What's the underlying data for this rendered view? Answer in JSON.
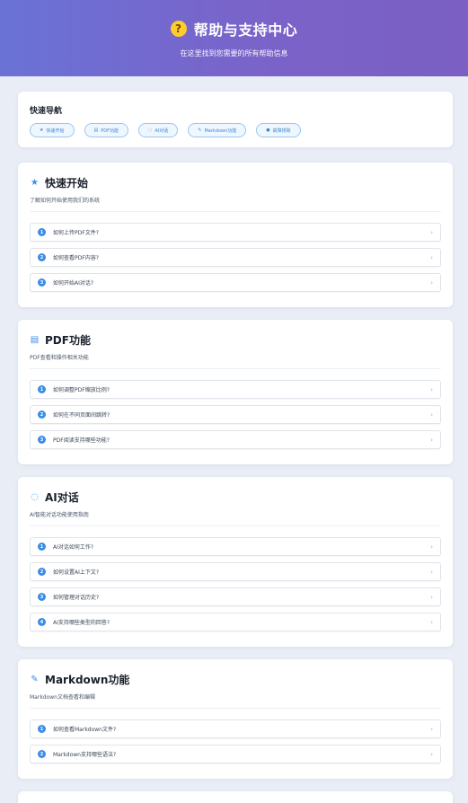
{
  "hero": {
    "icon": "question-icon",
    "title": "帮助与支持中心",
    "subtitle": "在这里找到您需要的所有帮助信息"
  },
  "quick_nav": {
    "title": "快速导航",
    "chips": [
      {
        "icon": "star-icon",
        "glyph": "★",
        "label": "快速开始"
      },
      {
        "icon": "document-icon",
        "glyph": "▤",
        "label": "PDF功能"
      },
      {
        "icon": "chat-icon",
        "glyph": "◌",
        "label": "AI对话"
      },
      {
        "icon": "edit-icon",
        "glyph": "✎",
        "label": "Markdown功能"
      },
      {
        "icon": "troubleshoot-icon",
        "glyph": "●",
        "label": "故障排除"
      }
    ]
  },
  "sections": [
    {
      "icon": "star-icon",
      "glyph": "★",
      "title": "快速开始",
      "desc": "了解如何开始使用我们的系统",
      "items": [
        "如何上传PDF文件?",
        "如何查看PDF内容?",
        "如何开始AI对话?"
      ]
    },
    {
      "icon": "document-icon",
      "glyph": "▤",
      "title": "PDF功能",
      "desc": "PDF查看和操作相关功能",
      "items": [
        "如何调整PDF缩放比例?",
        "如何在不同页面间跳转?",
        "PDF阅读支持哪些功能?"
      ]
    },
    {
      "icon": "chat-icon",
      "glyph": "◌",
      "title": "AI对话",
      "desc": "AI智能对话功能使用指南",
      "items": [
        "AI对话如何工作?",
        "如何设置AI上下文?",
        "如何管理对话历史?",
        "AI支持哪些类型的回答?"
      ]
    },
    {
      "icon": "edit-icon",
      "glyph": "✎",
      "title": "Markdown功能",
      "desc": "Markdown文档查看和编辑",
      "items": [
        "如何查看Markdown文件?",
        "Markdown支持哪些语法?"
      ]
    }
  ],
  "chevron": "›",
  "colors": {
    "accent": "#3b8de6",
    "hero_start": "#6a72d6",
    "hero_end": "#7b5fc2",
    "badge": "#ffcc2e"
  }
}
